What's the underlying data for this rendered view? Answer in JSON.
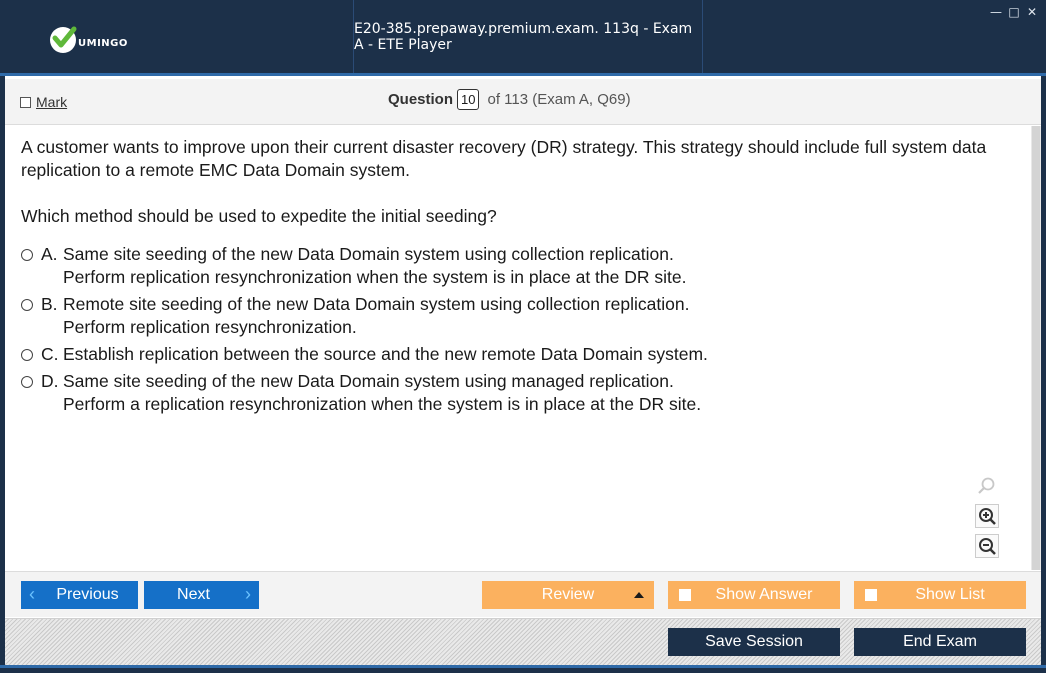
{
  "app": {
    "logo_text": "UMINGO",
    "title": "E20-385.prepaway.premium.exam. 113q - Exam A - ETE Player",
    "window_controls": [
      "minimize-icon",
      "maximize-icon",
      "close-icon"
    ]
  },
  "header": {
    "mark_label": "Mark",
    "question_label": "Question",
    "question_number": "10",
    "question_of": "of 113 (Exam A, Q69)"
  },
  "question": {
    "stem": [
      "A customer wants to improve upon their current disaster recovery (DR) strategy. This strategy should include full system data replication to a remote EMC Data Domain system.",
      "Which method should be used to expedite the initial seeding?"
    ],
    "choices": [
      {
        "letter": "A.",
        "text": "Same site seeding of the new Data Domain system using collection replication.\nPerform replication resynchronization when the system is in place at the DR site."
      },
      {
        "letter": "B.",
        "text": "Remote site seeding of the new Data Domain system using collection replication.\nPerform replication resynchronization."
      },
      {
        "letter": "C.",
        "text": "Establish replication between the source and the new remote Data Domain system."
      },
      {
        "letter": "D.",
        "text": "Same site seeding of the new Data Domain system using managed replication.\nPerform a replication resynchronization when the system is in place at the DR site."
      }
    ]
  },
  "zoom": {
    "icons": [
      "search-icon",
      "zoom-in-icon",
      "zoom-out-icon"
    ]
  },
  "nav": {
    "previous_label": "Previous",
    "next_label": "Next",
    "review_label": "Review",
    "show_answer_label": "Show Answer",
    "show_list_label": "Show List"
  },
  "footer": {
    "save_session_label": "Save Session",
    "end_exam_label": "End Exam"
  },
  "colors": {
    "titlebar": "#1c3049",
    "accent_blue": "#1570c8",
    "accent_orange": "#fbb15f",
    "logo_green": "#5fb83a"
  }
}
